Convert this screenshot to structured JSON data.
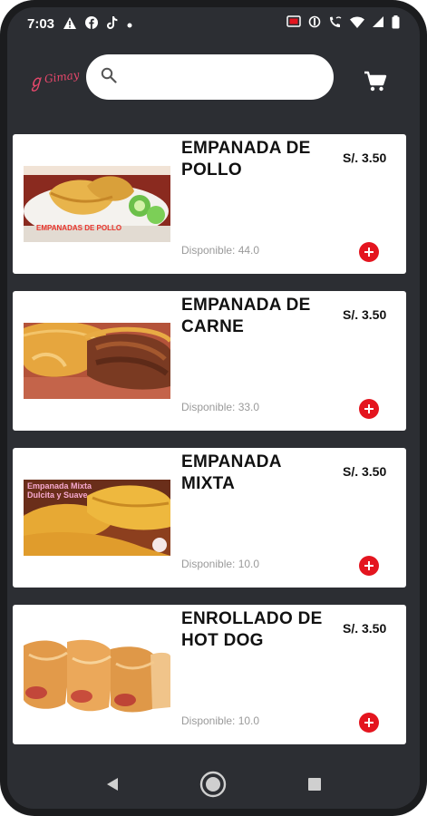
{
  "status_bar": {
    "time": "7:03",
    "icons_left": [
      "warning-icon",
      "facebook-icon",
      "tiktok-icon",
      "dot-icon"
    ],
    "icons_right": [
      "cast-icon",
      "sync-icon",
      "call-wifi-icon",
      "wifi-icon",
      "signal-icon",
      "battery-icon"
    ]
  },
  "header": {
    "logo_text": "Gimay",
    "search": {
      "value": "",
      "placeholder": ""
    },
    "cart_icon": "cart-icon"
  },
  "products": [
    {
      "name": "EMPANADA DE POLLO",
      "price": "S/. 3.50",
      "stock": "Disponible: 44.0",
      "image_text": "EMPANADAS DE POLLO"
    },
    {
      "name": "EMPANADA DE CARNE",
      "price": "S/. 3.50",
      "stock": "Disponible: 33.0"
    },
    {
      "name": "EMPANADA MIXTA",
      "price": "S/. 3.50",
      "stock": "Disponible: 10.0",
      "image_text": "Empanada Mixta Dulcita y Suave"
    },
    {
      "name": "ENROLLADO DE HOT DOG",
      "price": "S/. 3.50",
      "stock": "Disponible: 10.0"
    }
  ],
  "colors": {
    "background": "#2c2e33",
    "card": "#ffffff",
    "add_button": "#e4151f",
    "logo": "#e8486c",
    "stock_text": "#9a9a9a"
  },
  "nav_bar": {
    "buttons": [
      "back-icon",
      "home-icon",
      "recents-icon"
    ]
  }
}
